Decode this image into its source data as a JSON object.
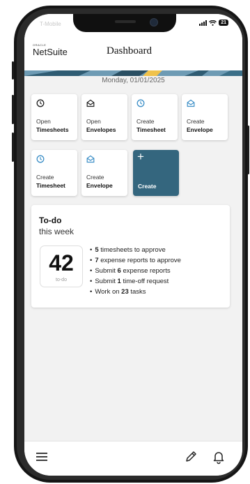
{
  "status_bar": {
    "carrier": "T-Mobile",
    "battery": "21"
  },
  "header": {
    "logo_small": "ORACLE",
    "logo": "NetSuite",
    "title": "Dashboard"
  },
  "date": "Monday, 01/01/2025",
  "tiles": [
    {
      "icon": "clock-icon",
      "line1": "Open",
      "line2": "Timesheets"
    },
    {
      "icon": "envelope-icon",
      "line1": "Open",
      "line2": "Envelopes"
    },
    {
      "icon": "clock-icon",
      "line1": "Create",
      "line2": "Timesheet"
    },
    {
      "icon": "envelope-icon",
      "line1": "Create",
      "line2": "Envelope"
    },
    {
      "icon": "clock-icon",
      "line1": "Create",
      "line2": "Timesheet"
    },
    {
      "icon": "envelope-icon",
      "line1": "Create",
      "line2": "Envelope"
    },
    {
      "icon": "plus-icon",
      "line1": "",
      "line2": "Create"
    }
  ],
  "todo": {
    "title": "To-do",
    "subtitle": "this week",
    "count": "42",
    "count_label": "to-do",
    "items": [
      {
        "bold": "5",
        "pre": "",
        "post": " timesheets to approve"
      },
      {
        "bold": "7",
        "pre": "",
        "post": " expense reports to approve"
      },
      {
        "bold": "6",
        "pre": "Submit ",
        "post": " expense reports"
      },
      {
        "bold": "1",
        "pre": "Submit ",
        "post": " time-off request"
      },
      {
        "bold": "23",
        "pre": "Work on ",
        "post": " tasks"
      }
    ]
  },
  "bottom_bar": {
    "left_icon": "menu-icon",
    "right_icons": [
      "pencil-icon",
      "bell-icon"
    ]
  },
  "colors": {
    "accent": "#34667e",
    "icon_blue": "#3d8fc7",
    "background": "#f2f2f2"
  }
}
